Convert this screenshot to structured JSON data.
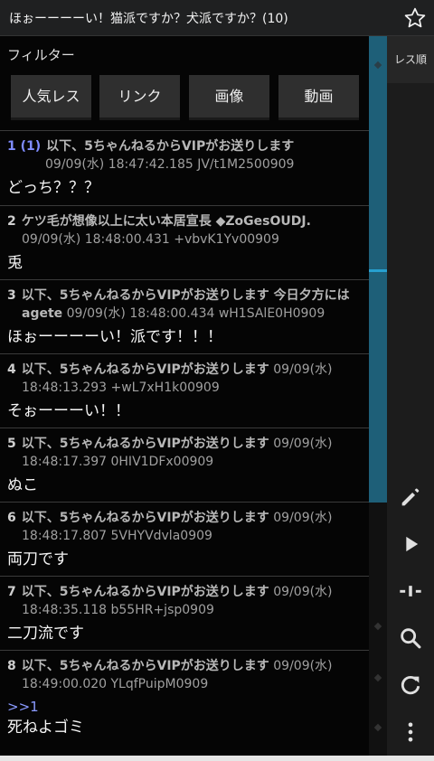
{
  "title": "ほぉーーーーい！猫派ですか？犬派ですか？(10)",
  "filter": {
    "label": "フィルター",
    "buttons": [
      "人気レス",
      "リンク",
      "画像",
      "動画"
    ]
  },
  "order_label": "レス順",
  "posts": [
    {
      "num": "1 (1)",
      "name": "以下、5ちゃんねるからVIPがお送りします",
      "meta": "09/09(水) 18:47:42.185 JV/t1M2500909",
      "body": "どっち？？？"
    },
    {
      "num": "2",
      "name": "ケツ毛が想像以上に太い本居宣長 ◆ZoGesOUDJ.",
      "meta": "09/09(水) 18:48:00.431 +vbvK1Yv00909",
      "body": "兎"
    },
    {
      "num": "3",
      "name": "以下、5ちゃんねるからVIPがお送りします 今日夕方には agete",
      "meta": "09/09(水) 18:48:00.434 wH1SAlE0H0909",
      "body": "ほぉーーーーい！派です！！！"
    },
    {
      "num": "4",
      "name": "以下、5ちゃんねるからVIPがお送りします",
      "meta": "09/09(水) 18:48:13.293 +wL7xH1k00909",
      "body": "そぉーーーい！！"
    },
    {
      "num": "5",
      "name": "以下、5ちゃんねるからVIPがお送りします",
      "meta": "09/09(水) 18:48:17.397 0HIV1DFx00909",
      "body": "ぬこ"
    },
    {
      "num": "6",
      "name": "以下、5ちゃんねるからVIPがお送りします",
      "meta": "09/09(水) 18:48:17.807 5VHYVdvla0909",
      "body": "両刀です"
    },
    {
      "num": "7",
      "name": "以下、5ちゃんねるからVIPがお送りします",
      "meta": "09/09(水) 18:48:35.118 b55HR+jsp0909",
      "body": "二刀流です"
    },
    {
      "num": "8",
      "name": "以下、5ちゃんねるからVIPがお送りします",
      "meta": "09/09(水) 18:49:00.020 YLqfPuipM0909",
      "anchor": ">>1",
      "body": "死ねよゴミ"
    }
  ],
  "icons": {
    "star": "star-outline-icon",
    "edit": "pencil-icon",
    "play": "play-icon",
    "jump": "jump-icon",
    "search": "search-icon",
    "refresh": "refresh-icon",
    "more": "more-vert-icon"
  },
  "colors": {
    "accent": "#27a0d0",
    "link": "#7f8cff",
    "scrollbar": "#1e5f78"
  }
}
